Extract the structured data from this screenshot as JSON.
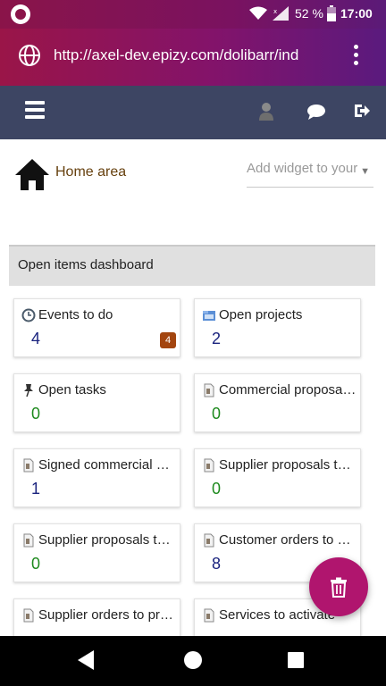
{
  "status_bar": {
    "battery": "52 %",
    "time": "17:00"
  },
  "browser": {
    "url": "http://axel-dev.epizy.com/dolibarr/ind"
  },
  "home": {
    "title": "Home area",
    "widget_placeholder": "Add widget to your"
  },
  "dashboard": {
    "title": "Open items dashboard",
    "cards": [
      {
        "label": "Events to do",
        "value": "4",
        "badge": "4",
        "icon": "clock-icon"
      },
      {
        "label": "Open projects",
        "value": "2",
        "icon": "projects-icon"
      },
      {
        "label": "Open tasks",
        "value": "0",
        "icon": "pin-icon"
      },
      {
        "label": "Commercial proposals to be signed",
        "value": "0",
        "icon": "document-icon"
      },
      {
        "label": "Signed commercial proposals to bill",
        "value": "1",
        "icon": "document-icon"
      },
      {
        "label": "Supplier proposals to be signed",
        "value": "0",
        "icon": "document-icon"
      },
      {
        "label": "Supplier proposals to be processed",
        "value": "0",
        "icon": "document-icon"
      },
      {
        "label": "Customer orders to process",
        "value": "8",
        "icon": "document-icon"
      },
      {
        "label": "Supplier orders to process",
        "value": "",
        "icon": "document-icon"
      },
      {
        "label": "Services to activate",
        "value": "",
        "icon": "document-icon"
      }
    ]
  },
  "colors": {
    "header": "#3d4563",
    "accent": "#b0156e",
    "badge": "#a3450f",
    "value_blue": "#1a237e",
    "value_green": "#1e8a1e"
  }
}
